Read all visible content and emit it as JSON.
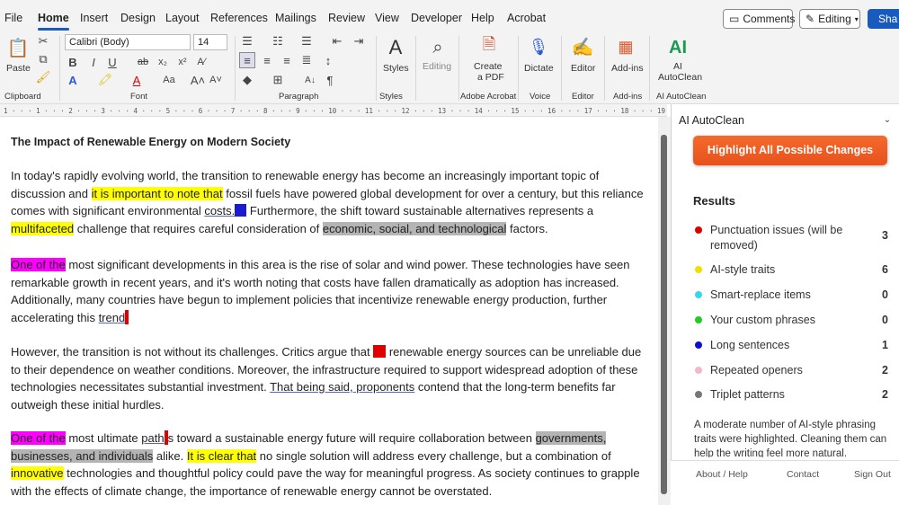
{
  "menubar": {
    "items": [
      "File",
      "Home",
      "Insert",
      "Design",
      "Layout",
      "References",
      "Mailings",
      "Review",
      "View",
      "Developer",
      "Help",
      "Acrobat"
    ],
    "comments": "Comments",
    "editing": "Editing",
    "share": "Sha"
  },
  "ribbon": {
    "paste": "Paste",
    "clipboard": "Clipboard",
    "font_name": "Calibri (Body)",
    "font_size": "14",
    "font": "Font",
    "paragraph": "Paragraph",
    "styles_btn": "Styles",
    "styles_group": "Styles",
    "editing_btn": "Editing",
    "create_pdf": [
      "Create",
      "a PDF"
    ],
    "adobe_acrobat": "Adobe Acrobat",
    "dictate": "Dictate",
    "voice": "Voice",
    "editor_btn": "Editor",
    "editor_group": "Editor",
    "addins_btn": "Add-ins",
    "addins_group": "Add-ins",
    "ai_icon": "AI",
    "ai_btn": [
      "AI",
      "AutoClean"
    ],
    "ai_group": "AI AutoClean"
  },
  "ruler": "1 · · · 1 · · · 2 · · · 3 · · · 4 · · · 5 · · · 6 · · · 7 · · · 8 · · · 9 · · · 10 · · · 11 · · · 12 · · · 13 · · · 14 · · · 15 · · · 16 · · · 17 · · · 18 · · · 19 · · · 20 · · · 21 · · · 22 · · · 23 · · · 24 · · · 25",
  "document": {
    "title": "The Impact of Renewable Energy on Modern Society",
    "p1": {
      "a": "In today's rapidly evolving world, the transition to renewable energy has become an increasingly important topic of discussion and ",
      "b": "it is important to note that",
      "c": " fossil fuels have powered global development for over a century, but this reliance comes with significant environmental ",
      "d": "costs.",
      "e": " Furthermore, the shift toward sustainable alternatives represents a ",
      "f": "multifaceted",
      "g": " challenge that requires careful consideration of ",
      "h": "economic, social, and technological",
      "i": " factors."
    },
    "p2": {
      "a": "One of the",
      "b": " most significant developments in this area is the rise of solar and wind power. These technologies have seen remarkable growth in recent years, and it's worth noting that costs have fallen dramatically as adoption has increased. Additionally, many countries have begun to implement policies that incentivize renewable energy production, further accelerating this ",
      "c": "trend"
    },
    "p3": {
      "a": "However, the transition is not without its challenges. Critics argue that ",
      "b": " renewable energy sources can be unreliable due to their dependence on weather conditions. Moreover, the infrastructure required to support widespread adoption of these technologies necessitates substantial investment. ",
      "c": "That being said, proponents",
      "d": " contend that the long-term benefits far outweigh these initial hurdles."
    },
    "p4": {
      "a": "One of the",
      "b": " most ultimate ",
      "c": "path",
      "d": "s toward a sustainable energy future will require collaboration between ",
      "e": "governments, businesses, and individuals",
      "f": " alike. ",
      "g": "It is clear that",
      "h": " no single solution will address every challenge, but a combination of ",
      "i": "innovative",
      "j": " technologies and thoughtful policy could pave the way for meaningful progress. As society continues to grapple with the effects of climate change, the importance of renewable energy cannot be overstated."
    }
  },
  "panel": {
    "title": "AI AutoClean",
    "highlight_button": "Highlight All Possible Changes",
    "results_heading": "Results",
    "results": [
      {
        "label": "Punctuation issues (will be removed)",
        "count": "3",
        "color": "#e00000"
      },
      {
        "label": "AI-style traits",
        "count": "6",
        "color": "#f0e000"
      },
      {
        "label": "Smart-replace items",
        "count": "0",
        "color": "#38d6e8"
      },
      {
        "label": "Your custom phrases",
        "count": "0",
        "color": "#22cc22"
      },
      {
        "label": "Long sentences",
        "count": "1",
        "color": "#1010cc"
      },
      {
        "label": "Repeated openers",
        "count": "2",
        "color": "#f4b8c4"
      },
      {
        "label": "Triplet patterns",
        "count": "2",
        "color": "#777777"
      }
    ],
    "summary": "A moderate number of AI-style phrasing traits were highlighted. Cleaning them can help the writing feel more natural.",
    "footer": {
      "about": "About / Help",
      "contact": "Contact",
      "signout": "Sign Out"
    }
  }
}
